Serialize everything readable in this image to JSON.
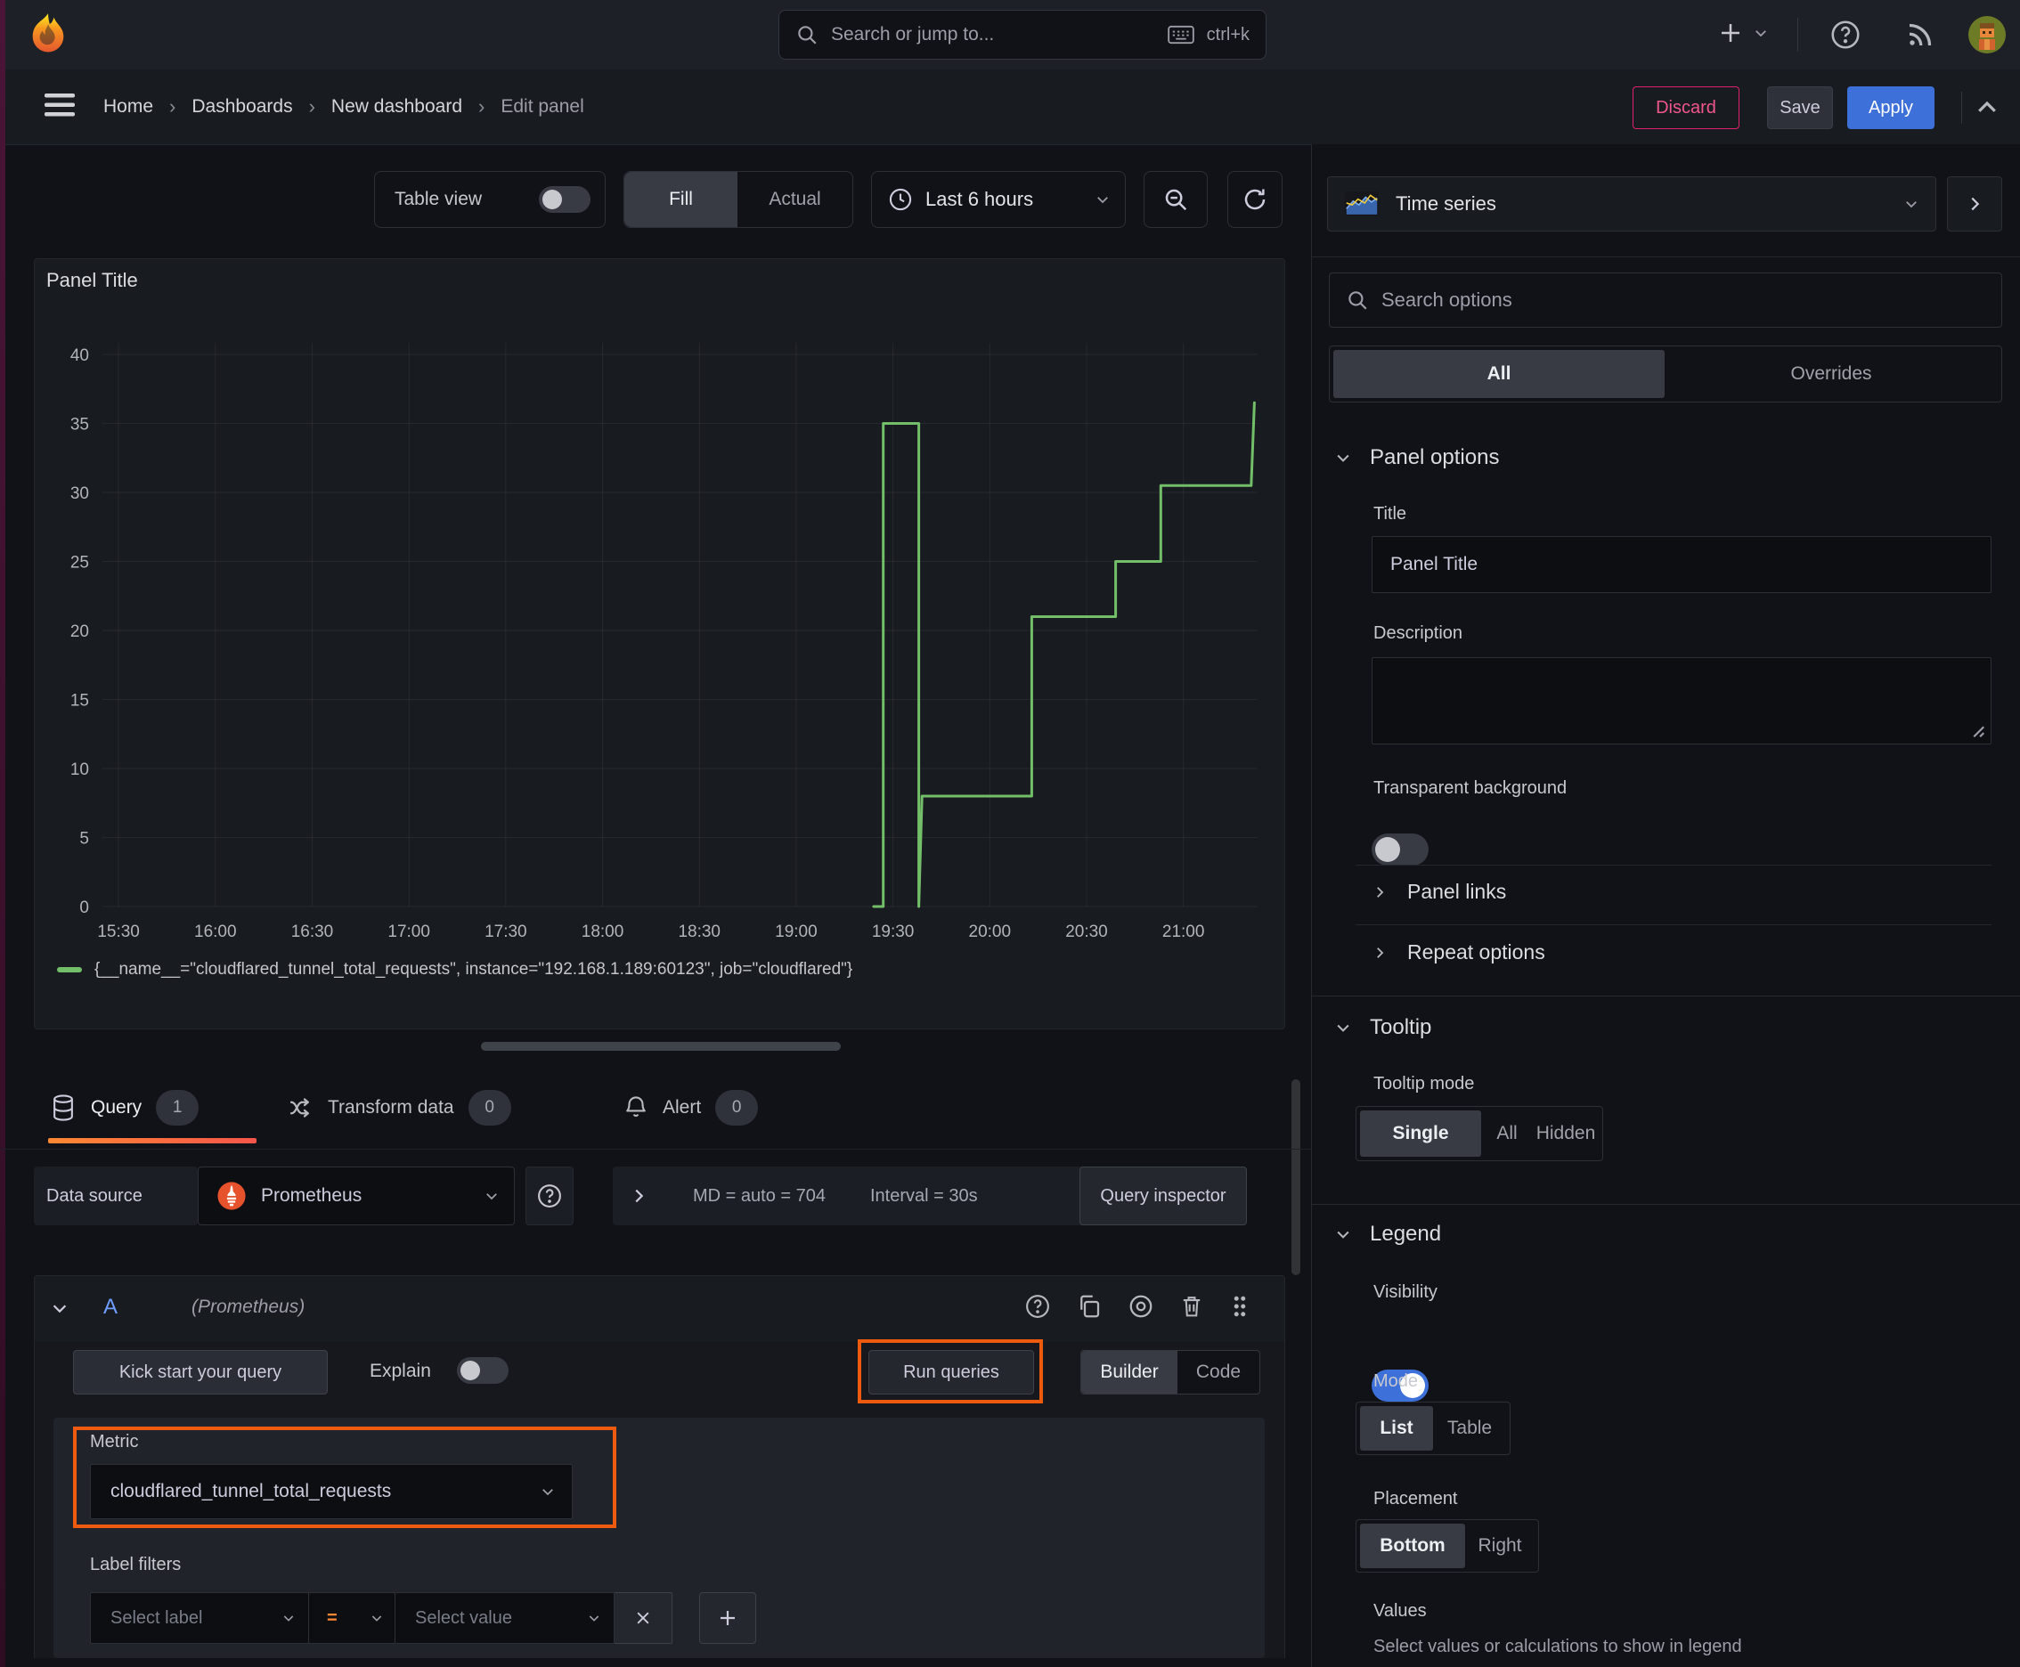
{
  "topbar": {
    "search_placeholder": "Search or jump to...",
    "shortcut": "ctrl+k"
  },
  "breadcrumb": {
    "items": [
      "Home",
      "Dashboards",
      "New dashboard",
      "Edit panel"
    ]
  },
  "actions": {
    "discard": "Discard",
    "save": "Save",
    "apply": "Apply"
  },
  "panel_toolbar": {
    "table_view": "Table view",
    "fill": "Fill",
    "actual": "Actual",
    "time_range": "Last 6 hours"
  },
  "panel": {
    "title": "Panel Title",
    "legend_label": "{__name__=\"cloudflared_tunnel_total_requests\", instance=\"192.168.1.189:60123\", job=\"cloudflared\"}"
  },
  "chart_data": {
    "type": "line",
    "title": "Panel Title",
    "x_ticks": [
      "15:30",
      "16:00",
      "16:30",
      "17:00",
      "17:30",
      "18:00",
      "18:30",
      "19:00",
      "19:30",
      "20:00",
      "20:30",
      "21:00"
    ],
    "x_range": [
      "15:25",
      "21:23"
    ],
    "y_ticks": [
      0,
      5,
      10,
      15,
      20,
      25,
      30,
      35,
      40
    ],
    "y_range": [
      0,
      40
    ],
    "grid": true,
    "legend_position": "bottom",
    "series": [
      {
        "name": "{__name__=\"cloudflared_tunnel_total_requests\", instance=\"192.168.1.189:60123\", job=\"cloudflared\"}",
        "color": "#73bf69",
        "points": [
          [
            "19:24",
            0
          ],
          [
            "19:27",
            0
          ],
          [
            "19:27",
            35
          ],
          [
            "19:38",
            35
          ],
          [
            "19:38",
            0
          ],
          [
            "19:39",
            8
          ],
          [
            "20:13",
            8
          ],
          [
            "20:13",
            21
          ],
          [
            "20:39",
            21
          ],
          [
            "20:39",
            25
          ],
          [
            "20:53",
            25
          ],
          [
            "20:53",
            30.5
          ],
          [
            "21:21",
            30.5
          ],
          [
            "21:22",
            36.5
          ]
        ]
      }
    ]
  },
  "tabs": {
    "query_label": "Query",
    "query_count": "1",
    "transform_label": "Transform data",
    "transform_count": "0",
    "alert_label": "Alert",
    "alert_count": "0"
  },
  "datasource_row": {
    "label": "Data source",
    "datasource": "Prometheus",
    "stat_md": "MD = auto = 704",
    "stat_interval": "Interval = 30s",
    "query_inspector": "Query inspector"
  },
  "query_editor": {
    "ref_id": "A",
    "datasource_hint": "(Prometheus)",
    "kick_start": "Kick start your query",
    "explain": "Explain",
    "run_queries": "Run queries",
    "builder": "Builder",
    "code": "Code",
    "metric_label": "Metric",
    "metric_value": "cloudflared_tunnel_total_requests",
    "label_filters_label": "Label filters",
    "select_label_placeholder": "Select label",
    "operator": "=",
    "select_value_placeholder": "Select value"
  },
  "options_pane": {
    "visualization": "Time series",
    "search_placeholder": "Search options",
    "filter_all": "All",
    "filter_overrides": "Overrides",
    "panel_options": {
      "heading": "Panel options",
      "title_label": "Title",
      "title_value": "Panel Title",
      "description_label": "Description",
      "transparent_label": "Transparent background"
    },
    "panel_links": "Panel links",
    "repeat_options": "Repeat options",
    "tooltip": {
      "heading": "Tooltip",
      "mode_label": "Tooltip mode",
      "modes": [
        "Single",
        "All",
        "Hidden"
      ]
    },
    "legend": {
      "heading": "Legend",
      "visibility_label": "Visibility",
      "mode_label": "Mode",
      "modes": [
        "List",
        "Table"
      ],
      "placement_label": "Placement",
      "placements": [
        "Bottom",
        "Right"
      ],
      "values_label": "Values",
      "values_hint": "Select values or calculations to show in legend"
    }
  },
  "colors": {
    "accent_orange": "#ee5b0e",
    "series_green": "#73bf69",
    "primary_blue": "#3d71d9",
    "danger_pink": "#e0226e",
    "selected_segment": "#383b44",
    "panel_bg": "#181b1f",
    "page_bg": "#111217"
  }
}
